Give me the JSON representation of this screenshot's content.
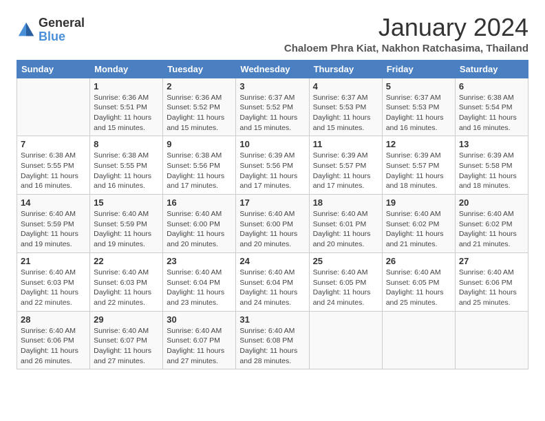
{
  "logo": {
    "general": "General",
    "blue": "Blue"
  },
  "title": "January 2024",
  "subtitle": "Chaloem Phra Kiat, Nakhon Ratchasima, Thailand",
  "headers": [
    "Sunday",
    "Monday",
    "Tuesday",
    "Wednesday",
    "Thursday",
    "Friday",
    "Saturday"
  ],
  "weeks": [
    [
      {
        "day": "",
        "sunrise": "",
        "sunset": "",
        "daylight": ""
      },
      {
        "day": "1",
        "sunrise": "Sunrise: 6:36 AM",
        "sunset": "Sunset: 5:51 PM",
        "daylight": "Daylight: 11 hours and 15 minutes."
      },
      {
        "day": "2",
        "sunrise": "Sunrise: 6:36 AM",
        "sunset": "Sunset: 5:52 PM",
        "daylight": "Daylight: 11 hours and 15 minutes."
      },
      {
        "day": "3",
        "sunrise": "Sunrise: 6:37 AM",
        "sunset": "Sunset: 5:52 PM",
        "daylight": "Daylight: 11 hours and 15 minutes."
      },
      {
        "day": "4",
        "sunrise": "Sunrise: 6:37 AM",
        "sunset": "Sunset: 5:53 PM",
        "daylight": "Daylight: 11 hours and 15 minutes."
      },
      {
        "day": "5",
        "sunrise": "Sunrise: 6:37 AM",
        "sunset": "Sunset: 5:53 PM",
        "daylight": "Daylight: 11 hours and 16 minutes."
      },
      {
        "day": "6",
        "sunrise": "Sunrise: 6:38 AM",
        "sunset": "Sunset: 5:54 PM",
        "daylight": "Daylight: 11 hours and 16 minutes."
      }
    ],
    [
      {
        "day": "7",
        "sunrise": "Sunrise: 6:38 AM",
        "sunset": "Sunset: 5:55 PM",
        "daylight": "Daylight: 11 hours and 16 minutes."
      },
      {
        "day": "8",
        "sunrise": "Sunrise: 6:38 AM",
        "sunset": "Sunset: 5:55 PM",
        "daylight": "Daylight: 11 hours and 16 minutes."
      },
      {
        "day": "9",
        "sunrise": "Sunrise: 6:38 AM",
        "sunset": "Sunset: 5:56 PM",
        "daylight": "Daylight: 11 hours and 17 minutes."
      },
      {
        "day": "10",
        "sunrise": "Sunrise: 6:39 AM",
        "sunset": "Sunset: 5:56 PM",
        "daylight": "Daylight: 11 hours and 17 minutes."
      },
      {
        "day": "11",
        "sunrise": "Sunrise: 6:39 AM",
        "sunset": "Sunset: 5:57 PM",
        "daylight": "Daylight: 11 hours and 17 minutes."
      },
      {
        "day": "12",
        "sunrise": "Sunrise: 6:39 AM",
        "sunset": "Sunset: 5:57 PM",
        "daylight": "Daylight: 11 hours and 18 minutes."
      },
      {
        "day": "13",
        "sunrise": "Sunrise: 6:39 AM",
        "sunset": "Sunset: 5:58 PM",
        "daylight": "Daylight: 11 hours and 18 minutes."
      }
    ],
    [
      {
        "day": "14",
        "sunrise": "Sunrise: 6:40 AM",
        "sunset": "Sunset: 5:59 PM",
        "daylight": "Daylight: 11 hours and 19 minutes."
      },
      {
        "day": "15",
        "sunrise": "Sunrise: 6:40 AM",
        "sunset": "Sunset: 5:59 PM",
        "daylight": "Daylight: 11 hours and 19 minutes."
      },
      {
        "day": "16",
        "sunrise": "Sunrise: 6:40 AM",
        "sunset": "Sunset: 6:00 PM",
        "daylight": "Daylight: 11 hours and 20 minutes."
      },
      {
        "day": "17",
        "sunrise": "Sunrise: 6:40 AM",
        "sunset": "Sunset: 6:00 PM",
        "daylight": "Daylight: 11 hours and 20 minutes."
      },
      {
        "day": "18",
        "sunrise": "Sunrise: 6:40 AM",
        "sunset": "Sunset: 6:01 PM",
        "daylight": "Daylight: 11 hours and 20 minutes."
      },
      {
        "day": "19",
        "sunrise": "Sunrise: 6:40 AM",
        "sunset": "Sunset: 6:02 PM",
        "daylight": "Daylight: 11 hours and 21 minutes."
      },
      {
        "day": "20",
        "sunrise": "Sunrise: 6:40 AM",
        "sunset": "Sunset: 6:02 PM",
        "daylight": "Daylight: 11 hours and 21 minutes."
      }
    ],
    [
      {
        "day": "21",
        "sunrise": "Sunrise: 6:40 AM",
        "sunset": "Sunset: 6:03 PM",
        "daylight": "Daylight: 11 hours and 22 minutes."
      },
      {
        "day": "22",
        "sunrise": "Sunrise: 6:40 AM",
        "sunset": "Sunset: 6:03 PM",
        "daylight": "Daylight: 11 hours and 22 minutes."
      },
      {
        "day": "23",
        "sunrise": "Sunrise: 6:40 AM",
        "sunset": "Sunset: 6:04 PM",
        "daylight": "Daylight: 11 hours and 23 minutes."
      },
      {
        "day": "24",
        "sunrise": "Sunrise: 6:40 AM",
        "sunset": "Sunset: 6:04 PM",
        "daylight": "Daylight: 11 hours and 24 minutes."
      },
      {
        "day": "25",
        "sunrise": "Sunrise: 6:40 AM",
        "sunset": "Sunset: 6:05 PM",
        "daylight": "Daylight: 11 hours and 24 minutes."
      },
      {
        "day": "26",
        "sunrise": "Sunrise: 6:40 AM",
        "sunset": "Sunset: 6:05 PM",
        "daylight": "Daylight: 11 hours and 25 minutes."
      },
      {
        "day": "27",
        "sunrise": "Sunrise: 6:40 AM",
        "sunset": "Sunset: 6:06 PM",
        "daylight": "Daylight: 11 hours and 25 minutes."
      }
    ],
    [
      {
        "day": "28",
        "sunrise": "Sunrise: 6:40 AM",
        "sunset": "Sunset: 6:06 PM",
        "daylight": "Daylight: 11 hours and 26 minutes."
      },
      {
        "day": "29",
        "sunrise": "Sunrise: 6:40 AM",
        "sunset": "Sunset: 6:07 PM",
        "daylight": "Daylight: 11 hours and 27 minutes."
      },
      {
        "day": "30",
        "sunrise": "Sunrise: 6:40 AM",
        "sunset": "Sunset: 6:07 PM",
        "daylight": "Daylight: 11 hours and 27 minutes."
      },
      {
        "day": "31",
        "sunrise": "Sunrise: 6:40 AM",
        "sunset": "Sunset: 6:08 PM",
        "daylight": "Daylight: 11 hours and 28 minutes."
      },
      {
        "day": "",
        "sunrise": "",
        "sunset": "",
        "daylight": ""
      },
      {
        "day": "",
        "sunrise": "",
        "sunset": "",
        "daylight": ""
      },
      {
        "day": "",
        "sunrise": "",
        "sunset": "",
        "daylight": ""
      }
    ]
  ]
}
